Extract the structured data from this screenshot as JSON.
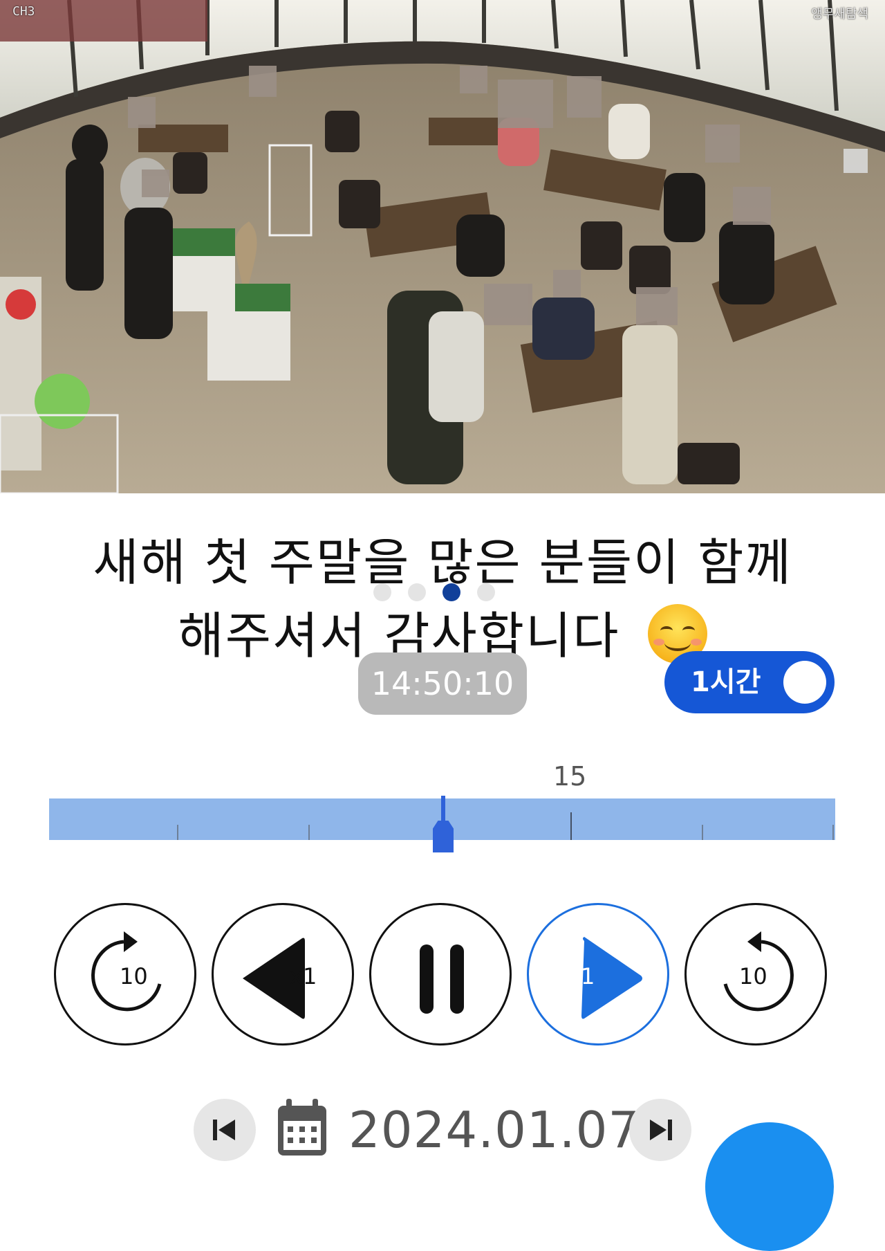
{
  "video": {
    "channel_label": "CH3",
    "camera_name": "앵무새탐색"
  },
  "caption": {
    "line1": "새해 첫 주말을 많은 분들이 함께",
    "line2": "해주셔서 감사합니다",
    "emoji": "smiling-face-emoji"
  },
  "pager": {
    "count": 4,
    "active_index": 2
  },
  "playback": {
    "current_time": "14:50:10",
    "range_toggle_label": "1시간",
    "range_toggle_on": true
  },
  "timeline": {
    "label": "15",
    "cursor_fraction": 0.5
  },
  "controls": {
    "rewind_label": "10",
    "reverse_speed_label": "x1",
    "forward_speed_label": "x1",
    "forward_label": "10"
  },
  "date_bar": {
    "date": "2024.01.07"
  },
  "colors": {
    "accent": "#1557d6",
    "timeline_fill": "#8fb6ea",
    "cursor": "#2f62d9",
    "play_blue": "#1c6fde",
    "pager_active": "#11409a"
  }
}
